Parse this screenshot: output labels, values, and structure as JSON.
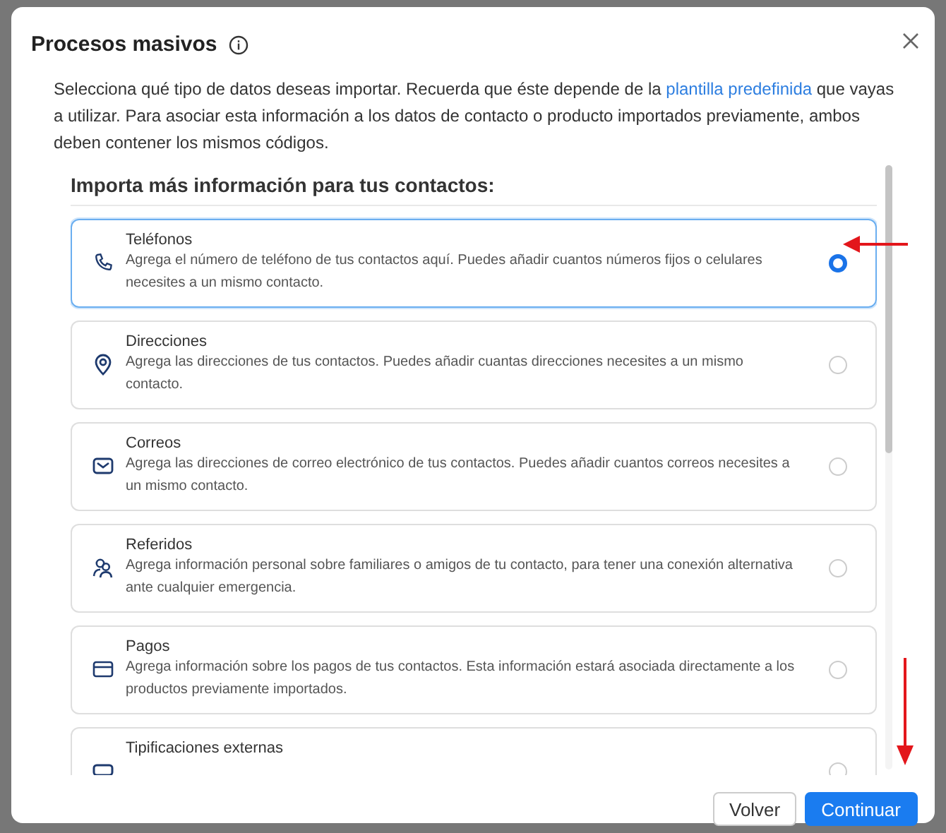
{
  "dialog": {
    "title": "Procesos masivos"
  },
  "intro": {
    "before": "Selecciona qué tipo de datos deseas importar. Recuerda que éste depende de la ",
    "link": "plantilla predefinida",
    "after": " que vayas a utilizar. Para asociar esta información a los datos de contacto o producto importados previamente, ambos deben contener los mismos códigos."
  },
  "section_title": "Importa más información para tus contactos:",
  "options": [
    {
      "kind": "phone",
      "title": "Teléfonos",
      "description": "Agrega el número de teléfono de tus contactos aquí. Puedes añadir cuantos números fijos o celulares necesites a un mismo contacto.",
      "selected": true
    },
    {
      "kind": "pin",
      "title": "Direcciones",
      "description": "Agrega las direcciones de tus contactos. Puedes añadir cuantas direcciones necesites a un mismo contacto.",
      "selected": false
    },
    {
      "kind": "mail",
      "title": "Correos",
      "description": "Agrega las direcciones de correo electrónico de tus contactos. Puedes añadir cuantos correos necesites a un mismo contacto.",
      "selected": false
    },
    {
      "kind": "people",
      "title": "Referidos",
      "description": "Agrega información personal sobre familiares o amigos de tu contacto, para tener una conexión alternativa ante cualquier emergencia.",
      "selected": false
    },
    {
      "kind": "card",
      "title": "Pagos",
      "description": "Agrega información sobre los pagos de tus contactos. Esta información estará asociada directamente a los productos previamente importados.",
      "selected": false
    },
    {
      "kind": "tag",
      "title": "Tipificaciones externas",
      "selected": false
    }
  ],
  "buttons": [
    {
      "kind": "secondary",
      "label": "Volver"
    },
    {
      "kind": "primary",
      "label": "Continuar"
    }
  ]
}
